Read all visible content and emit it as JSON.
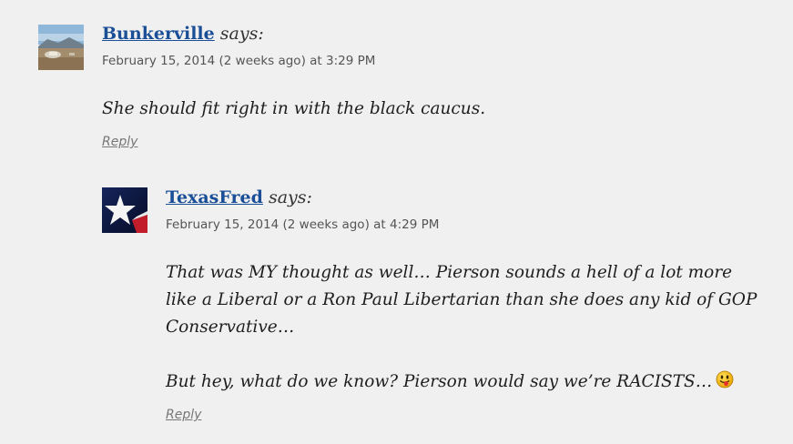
{
  "comments": [
    {
      "author": "Bunkerville",
      "says": "says:",
      "date": "February 15, 2014 (2 weeks ago) at 3:29 PM",
      "paragraphs": [
        "She should fit right in with the black caucus."
      ],
      "reply_label": "Reply",
      "avatar_icon": "landscape-avatar-icon"
    },
    {
      "author": "TexasFred",
      "says": "says:",
      "date": "February 15, 2014 (2 weeks ago) at 4:29 PM",
      "paragraphs": [
        "That was MY thought as well… Pierson sounds a hell of a lot more like a Liberal or a Ron Paul Libertarian than she does any kid of GOP Conservative…",
        "But hey, what do we know? Pierson would say we’re RACISTS…"
      ],
      "emoticon_icon": "tongue-out-smiley-icon",
      "reply_label": "Reply",
      "avatar_icon": "texas-flag-avatar-icon"
    }
  ],
  "colors": {
    "background": "#f0f0f0",
    "author_link": "#1a4e96",
    "meta_text": "#555555",
    "reply_link": "#777777"
  }
}
